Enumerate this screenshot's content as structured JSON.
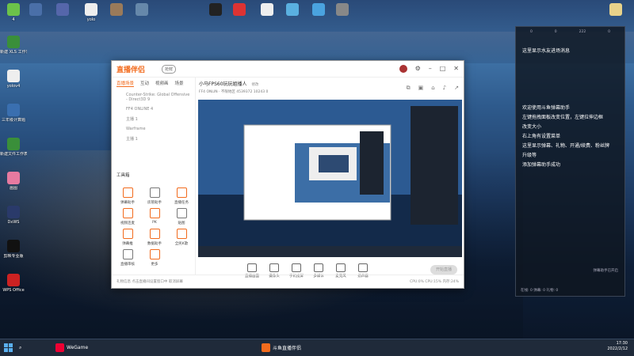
{
  "desktop": {
    "icons_top": [
      {
        "label": "4",
        "color": "#6cc24a"
      },
      {
        "label": "",
        "color": "#4a6fa8"
      },
      {
        "label": "",
        "color": "#5566aa"
      },
      {
        "label": "yolo",
        "color": "#eeeeee"
      },
      {
        "label": "",
        "color": "#9a7a5a"
      },
      {
        "label": "",
        "color": "#6688aa"
      },
      {
        "label": "",
        "color": "#222222"
      },
      {
        "label": "",
        "color": "#d33"
      },
      {
        "label": "",
        "color": "#eeeeee"
      },
      {
        "label": "",
        "color": "#5ab0e0"
      },
      {
        "label": "",
        "color": "#4aa3df"
      },
      {
        "label": "",
        "color": "#888888"
      },
      {
        "label": "",
        "color": "#e8d28a"
      }
    ],
    "icons_left": [
      {
        "label": "新建 XLS 工作表",
        "color": "#3a8f3a"
      },
      {
        "label": "yolov4",
        "color": "#eeeeee"
      },
      {
        "label": "三年级计算题",
        "color": "#3a6fb0"
      },
      {
        "label": "新建文件工作表",
        "color": "#3a8f3a"
      },
      {
        "label": "画图",
        "color": "#e67aa0"
      },
      {
        "label": "DxWS",
        "color": "#2a3a6a"
      },
      {
        "label": "剪映专业版",
        "color": "#111111"
      },
      {
        "label": "WPS Office",
        "color": "#cc2222"
      }
    ]
  },
  "window": {
    "logo": "直播伴侣",
    "beta_badge": "抢鲜",
    "tabs": [
      "直播场景",
      "互动",
      "视频画",
      "场景"
    ],
    "scenes": [
      "Counter-Strike: Global Offensive - Direct3D 9",
      "FF4 ONLINE 4",
      "主播 1",
      "Warframe",
      "主播 1"
    ],
    "tools_title": "工具箱",
    "tools": [
      "弹幕助手",
      "房管助手",
      "直播任务",
      "视频连麦",
      "PK",
      "贴图",
      "弹幕推",
      "数据助手",
      "全民K歌",
      "直播审核",
      "更多"
    ],
    "room_title": "小马FPS60玩玩姐播人",
    "room_title_tag": "修改",
    "room_meta": "FF4 ONLIN · 不限地区    4539372    10243    0",
    "controls": [
      "直播画面",
      "摄像头",
      "手机投屏",
      "多媒体",
      "麦克风",
      "扬声器"
    ],
    "start_button": "开始直播",
    "status_text": "礼物信息   点击直播间设置窗口中   取消屏幕",
    "status_right": "CPU:0%   CPU:15%   内存:24%"
  },
  "chat_overlay": {
    "stats": [
      "0",
      "0",
      "222",
      "0"
    ],
    "top_msg": "这里显示水友进场消息",
    "messages": [
      "欢迎使用斗鱼弹幕助手",
      "左键拖拽面板改变位置，左键拉伸边框",
      "改变大小",
      "右上角有设置菜单",
      "这里显示弹幕、礼物、开通/续费、粉丝牌",
      "升级等",
      "添加弹幕助手成功"
    ],
    "footer_msg": "弹幕助手已开启",
    "bottom_stats": "在线: 0    弹幕: 0    礼物: 0"
  },
  "taskbar": {
    "items": [
      "WeGame",
      "斗鱼直播伴侣"
    ],
    "time": "17:30",
    "date": "2022/2/12"
  }
}
